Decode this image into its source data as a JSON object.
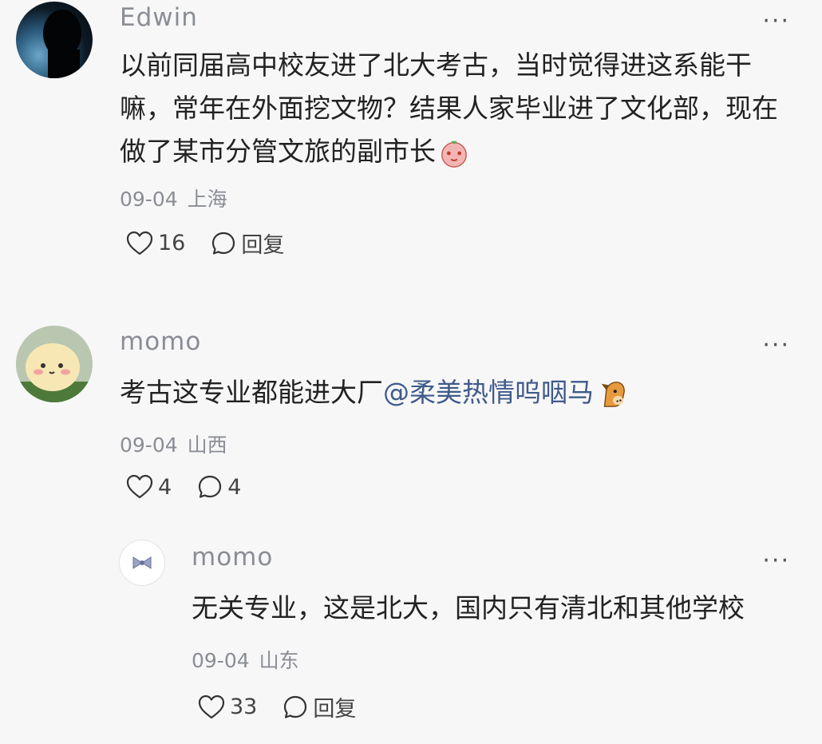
{
  "comments": [
    {
      "user": "Edwin",
      "more": "···",
      "text": "以前同届高中校友进了北大考古，当时觉得进这系能干嘛，常年在外面挖文物？结果人家毕业进了文化部，现在做了某市分管文旅的副市长",
      "emoji": "red-face-emoji",
      "date": "09-04",
      "location": "上海",
      "likes": "16",
      "reply": "回复"
    },
    {
      "user": "momo",
      "more": "···",
      "text": "考古这专业都能进大厂",
      "mention": "@柔美热情呜咽马",
      "emoji": "horse-emoji",
      "date": "09-04",
      "location": "山西",
      "likes": "4",
      "replies": "4"
    },
    {
      "user": "momo",
      "more": "···",
      "text": "无关专业，这是北大，国内只有清北和其他学校",
      "date": "09-04",
      "location": "山东",
      "likes": "33",
      "reply": "回复"
    }
  ],
  "colors": {
    "background": "#f7f7f8",
    "text": "#222222",
    "muted": "#8a8d93",
    "mention": "#3f5a8a"
  }
}
